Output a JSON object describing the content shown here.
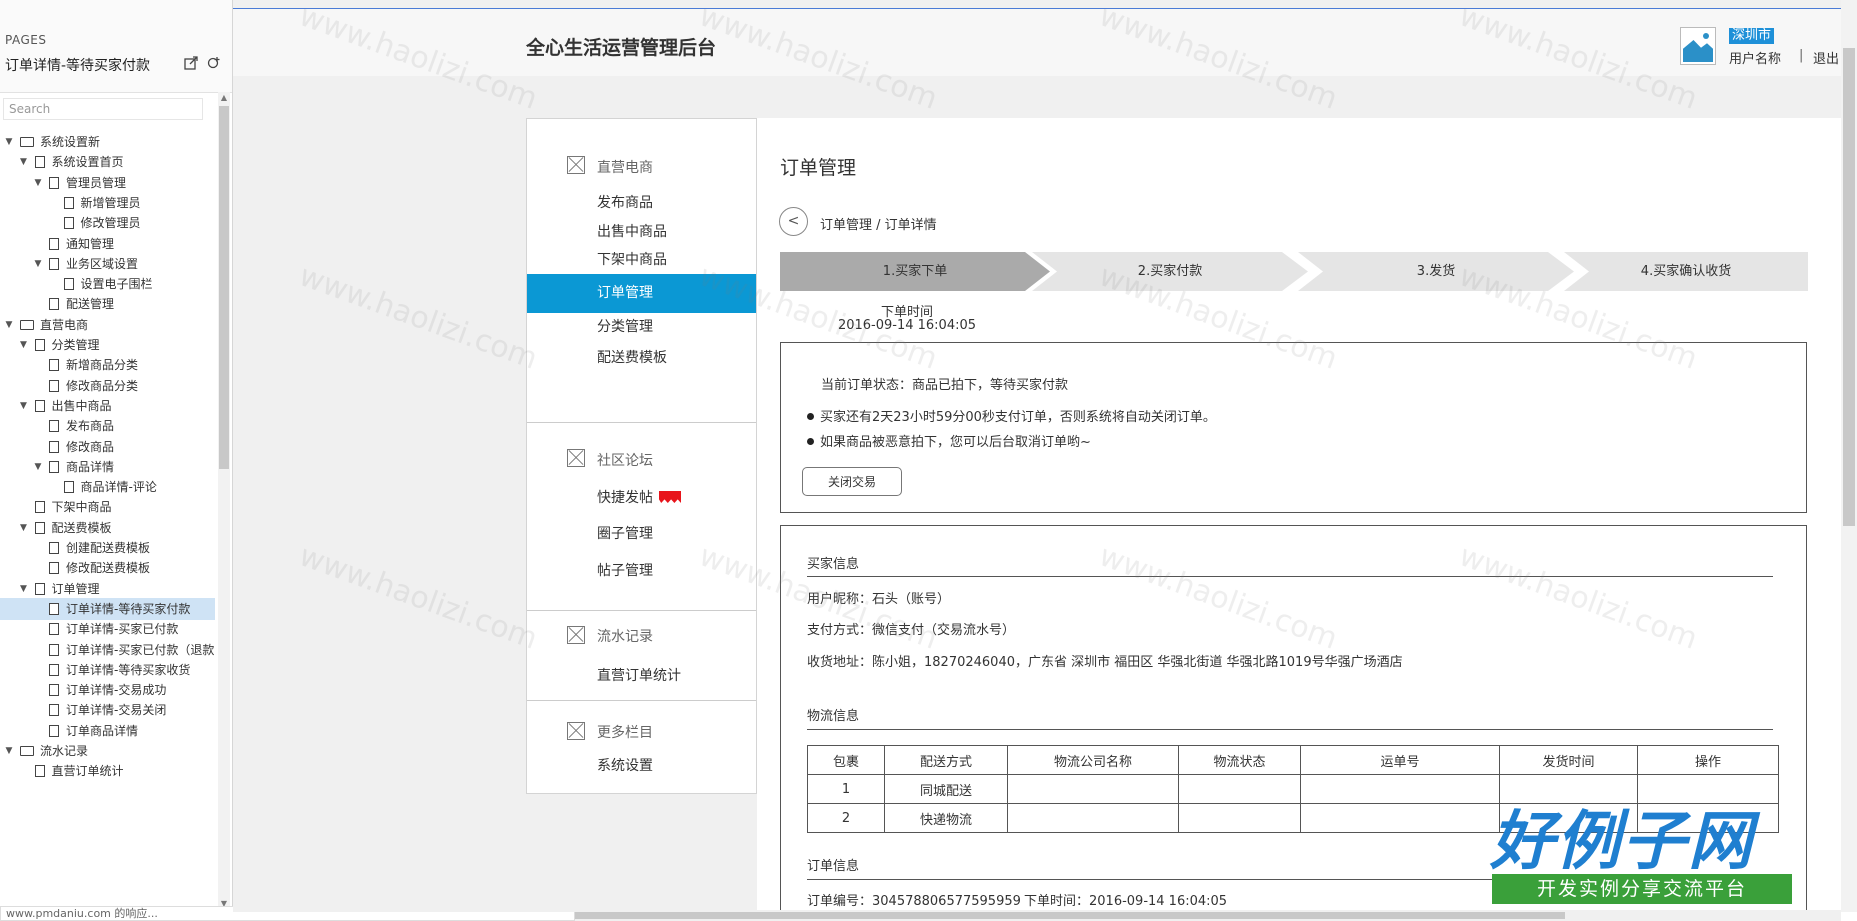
{
  "pages_panel": {
    "label": "PAGES",
    "current_page": "订单详情-等待买家付款",
    "search_placeholder": "Search",
    "tree": [
      {
        "label": "系统设置新",
        "level": 0,
        "type": "folder",
        "expanded": true
      },
      {
        "label": "系统设置首页",
        "level": 1,
        "type": "page",
        "expanded": true
      },
      {
        "label": "管理员管理",
        "level": 2,
        "type": "page",
        "expanded": true
      },
      {
        "label": "新增管理员",
        "level": 3,
        "type": "page"
      },
      {
        "label": "修改管理员",
        "level": 3,
        "type": "page"
      },
      {
        "label": "通知管理",
        "level": 2,
        "type": "page"
      },
      {
        "label": "业务区域设置",
        "level": 2,
        "type": "page",
        "expanded": true
      },
      {
        "label": "设置电子围栏",
        "level": 3,
        "type": "page"
      },
      {
        "label": "配送管理",
        "level": 2,
        "type": "page"
      },
      {
        "label": "直营电商",
        "level": 0,
        "type": "folder",
        "expanded": true
      },
      {
        "label": "分类管理",
        "level": 1,
        "type": "page",
        "expanded": true
      },
      {
        "label": "新增商品分类",
        "level": 2,
        "type": "page"
      },
      {
        "label": "修改商品分类",
        "level": 2,
        "type": "page"
      },
      {
        "label": "出售中商品",
        "level": 1,
        "type": "page",
        "expanded": true
      },
      {
        "label": "发布商品",
        "level": 2,
        "type": "page"
      },
      {
        "label": "修改商品",
        "level": 2,
        "type": "page"
      },
      {
        "label": "商品详情",
        "level": 2,
        "type": "page",
        "expanded": true
      },
      {
        "label": "商品详情-评论",
        "level": 3,
        "type": "page"
      },
      {
        "label": "下架中商品",
        "level": 1,
        "type": "page"
      },
      {
        "label": "配送费模板",
        "level": 1,
        "type": "page",
        "expanded": true
      },
      {
        "label": "创建配送费模板",
        "level": 2,
        "type": "page"
      },
      {
        "label": "修改配送费模板",
        "level": 2,
        "type": "page"
      },
      {
        "label": "订单管理",
        "level": 1,
        "type": "page",
        "expanded": true
      },
      {
        "label": "订单详情-等待买家付款",
        "level": 2,
        "type": "page",
        "selected": true
      },
      {
        "label": "订单详情-买家已付款",
        "level": 2,
        "type": "page"
      },
      {
        "label": "订单详情-买家已付款（退款",
        "level": 2,
        "type": "page"
      },
      {
        "label": "订单详情-等待买家收货",
        "level": 2,
        "type": "page"
      },
      {
        "label": "订单详情-交易成功",
        "level": 2,
        "type": "page"
      },
      {
        "label": "订单详情-交易关闭",
        "level": 2,
        "type": "page"
      },
      {
        "label": "订单商品详情",
        "level": 2,
        "type": "page"
      },
      {
        "label": "流水记录",
        "level": 0,
        "type": "folder",
        "expanded": true
      },
      {
        "label": "直营订单统计",
        "level": 1,
        "type": "page"
      }
    ]
  },
  "status_bar": "www.pmdaniu.com 的响应...",
  "header": {
    "app_title": "全心生活运营管理后台",
    "city": "深圳市",
    "user_name": "用户名称",
    "separator": "|",
    "logout": "退出"
  },
  "sidenav": {
    "sections": [
      {
        "title": "直营电商",
        "items": [
          "发布商品",
          "出售中商品",
          "下架中商品",
          "订单管理",
          "分类管理",
          "配送费模板"
        ]
      },
      {
        "title": "社区论坛",
        "items": [
          "快捷发帖",
          "圈子管理",
          "帖子管理"
        ]
      },
      {
        "title": "流水记录",
        "items": [
          "直营订单统计"
        ]
      },
      {
        "title": "更多栏目",
        "items": [
          "系统设置"
        ]
      }
    ],
    "active_item": "订单管理"
  },
  "content": {
    "title": "订单管理",
    "breadcrumb": "订单管理 / 订单详情",
    "back_icon": "chevron-left-icon",
    "steps": [
      "1.买家下单",
      "2.买家付款",
      "3.发货",
      "4.买家确认收货"
    ],
    "current_step": 1,
    "order_time_label": "下单时间",
    "order_time_value": "2016-09-14 16:04:05",
    "status": {
      "text": "当前订单状态：商品已拍下，等待买家付款",
      "bullets": [
        "买家还有2天23小时59分00秒支付订单，否则系统将自动关闭订单。",
        "如果商品被恶意拍下，您可以后台取消订单哟~"
      ],
      "close_button": "关闭交易"
    },
    "buyer": {
      "title": "买家信息",
      "nickname": "用户昵称：石头（账号）",
      "payment": "支付方式：微信支付（交易流水号）",
      "address": "收货地址：陈小姐，18270246040，广东省 深圳市 福田区 华强北街道 华强北路1019号华强广场酒店"
    },
    "logistics": {
      "title": "物流信息",
      "columns": [
        "包裹",
        "配送方式",
        "物流公司名称",
        "物流状态",
        "运单号",
        "发货时间",
        "操作"
      ],
      "rows": [
        [
          "1",
          "同城配送",
          "",
          "",
          "",
          "",
          ""
        ],
        [
          "2",
          "快递物流",
          "",
          "",
          "",
          "",
          ""
        ]
      ]
    },
    "order_info": {
      "title": "订单信息",
      "order_no": "订单编号：304578806577595959",
      "order_time": "下单时间：2016-09-14 16:04:05"
    }
  },
  "watermark": {
    "text": "www.haolizi.com",
    "brand_big": "好例子网",
    "brand_small": "开发实例分享交流平台"
  },
  "colors": {
    "accent": "#0b98d4",
    "link_highlight": "#1e90d8",
    "step_active": "#aaaaaa",
    "step_inactive": "#e5e5e5",
    "tree_selected": "#cfe3f5"
  }
}
